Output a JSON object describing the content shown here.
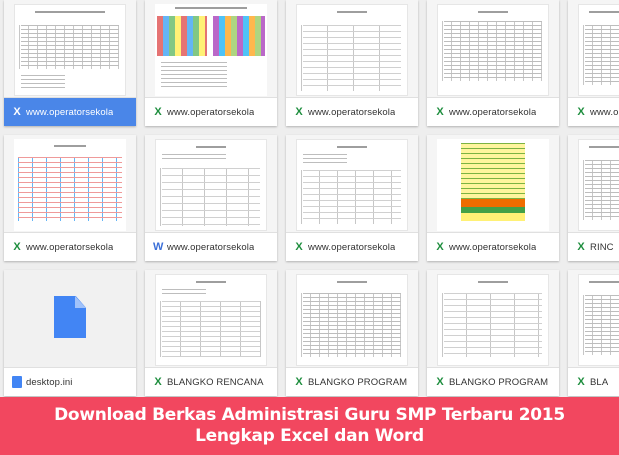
{
  "files": [
    {
      "name": "www.operatorsekola",
      "type": "excel",
      "selected": true
    },
    {
      "name": "www.operatorsekola",
      "type": "excel"
    },
    {
      "name": "www.operatorsekola",
      "type": "excel"
    },
    {
      "name": "www.operatorsekola",
      "type": "excel"
    },
    {
      "name": "www.operatorsekola",
      "type": "excel"
    },
    {
      "name": "www.operatorsekola",
      "type": "excel"
    },
    {
      "name": "www.operatorsekola",
      "type": "word"
    },
    {
      "name": "www.operatorsekola",
      "type": "excel"
    },
    {
      "name": "www.operatorsekola",
      "type": "excel"
    },
    {
      "name": "RINC",
      "type": "excel"
    },
    {
      "name": "desktop.ini",
      "type": "generic"
    },
    {
      "name": "BLANGKO RENCANA",
      "type": "excel"
    },
    {
      "name": "BLANGKO PROGRAM",
      "type": "excel"
    },
    {
      "name": "BLANGKO PROGRAM",
      "type": "excel"
    },
    {
      "name": "BLA",
      "type": "excel"
    }
  ],
  "icons": {
    "excel": "X",
    "word": "W"
  },
  "colors": {
    "selected": "#4a86e8",
    "excel": "#1e8e3e",
    "word": "#3b6fd8",
    "banner": "#f2475f"
  },
  "banner": {
    "text": "Download Berkas Administrasi Guru SMP Terbaru 2015 Lengkap Excel dan Word"
  }
}
